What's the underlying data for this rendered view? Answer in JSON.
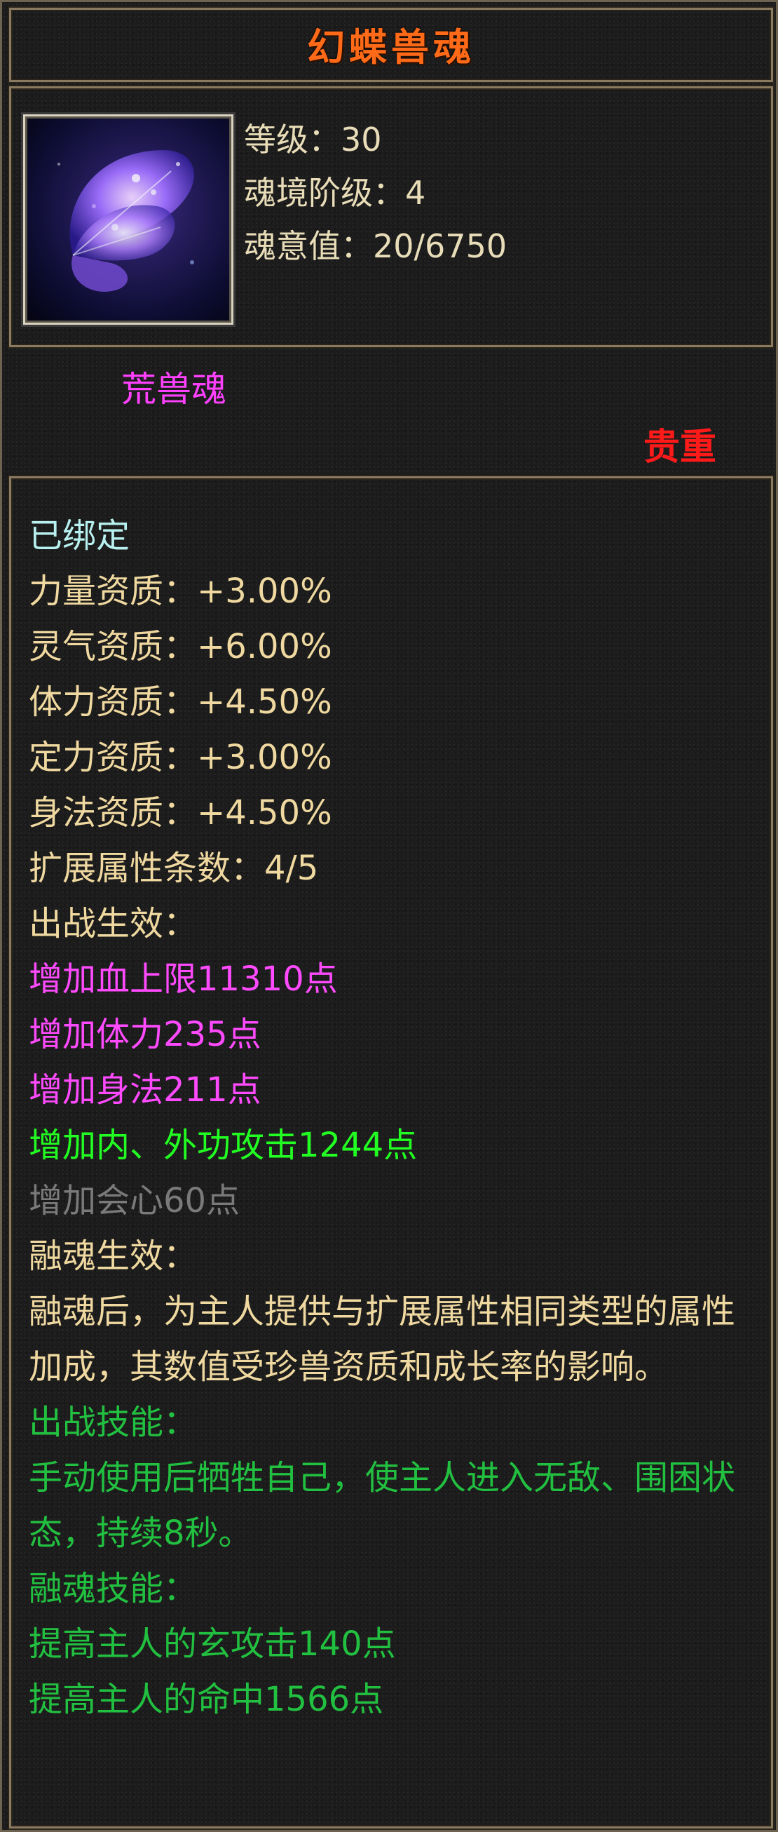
{
  "item": {
    "name": "幻蝶兽魂",
    "level": "等级：30",
    "realm": "魂境阶级：4",
    "soul_value": "魂意值：20/6750",
    "category": "荒兽魂",
    "rarity": "贵重",
    "icon": "butterfly-icon"
  },
  "colors": {
    "title": "#ff6a18",
    "category": "#ff40ff",
    "rarity": "#ff1a1a",
    "bound": "#b8f0f0",
    "tan": "#f0d9a0",
    "pink": "#ff4aff",
    "bright_green": "#22ff22",
    "gray": "#7a7a7a",
    "dark_green": "#22c040"
  },
  "attributes": {
    "bound": "已绑定",
    "strength": "力量资质：+3.00%",
    "spirit": "灵气资质：+6.00%",
    "stamina": "体力资质：+4.50%",
    "focus": "定力资质：+3.00%",
    "agility": "身法资质：+4.50%",
    "ext_count": "扩展属性条数：4/5"
  },
  "battle": {
    "header": "出战生效：",
    "effects": [
      "增加血上限11310点",
      "增加体力235点",
      "增加身法211点",
      "增加内、外功攻击1244点",
      "增加会心60点"
    ]
  },
  "fusion": {
    "header": "融魂生效：",
    "desc": "融魂后，为主人提供与扩展属性相同类型的属性加成，其数值受珍兽资质和成长率的影响。"
  },
  "battle_skill": {
    "header": "出战技能：",
    "desc": "手动使用后牺牲自己，使主人进入无敌、围困状态，持续8秒。"
  },
  "fusion_skill": {
    "header": "融魂技能：",
    "lines": [
      "提高主人的玄攻击140点",
      "提高主人的命中1566点"
    ]
  }
}
